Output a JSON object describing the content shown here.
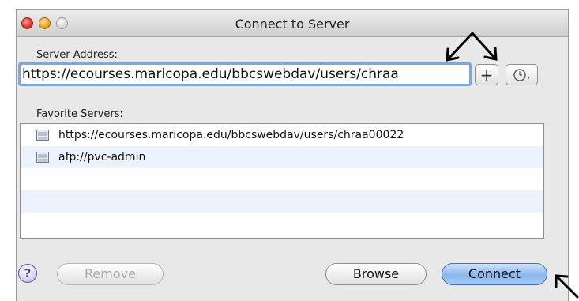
{
  "window": {
    "title": "Connect to Server"
  },
  "server_address": {
    "label": "Server Address:",
    "value": "https://ecourses.maricopa.edu/bbcswebdav/users/chraa",
    "add_label": "+"
  },
  "favorites": {
    "label": "Favorite Servers:",
    "items": [
      {
        "label": "https://ecourses.maricopa.edu/bbcswebdav/users/chraa00022",
        "icon": "server-icon"
      },
      {
        "label": "afp://pvc-admin",
        "icon": "server-icon"
      }
    ]
  },
  "buttons": {
    "help": "?",
    "remove": "Remove",
    "browse": "Browse",
    "connect": "Connect"
  },
  "colors": {
    "focus_ring": "#7aa7e0",
    "default_button": "#8ab6ee",
    "alt_row": "#edf3fe"
  }
}
